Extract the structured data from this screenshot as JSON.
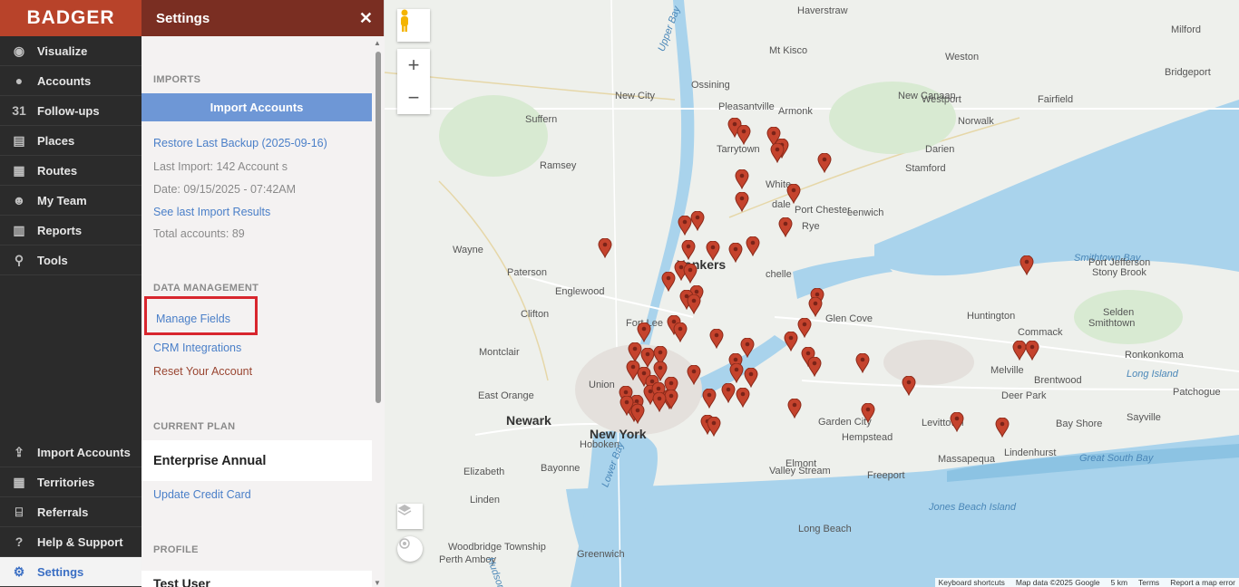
{
  "brand": "BADGER",
  "nav": {
    "top": [
      {
        "label": "Visualize",
        "icon": "eye-icon",
        "glyph": "◉"
      },
      {
        "label": "Accounts",
        "icon": "user-icon",
        "glyph": "●"
      },
      {
        "label": "Follow-ups",
        "icon": "calendar-icon",
        "glyph": "31"
      },
      {
        "label": "Places",
        "icon": "store-icon",
        "glyph": "▤"
      },
      {
        "label": "Routes",
        "icon": "map-icon",
        "glyph": "▦"
      },
      {
        "label": "My Team",
        "icon": "team-icon",
        "glyph": "☻"
      },
      {
        "label": "Reports",
        "icon": "report-icon",
        "glyph": "▥"
      },
      {
        "label": "Tools",
        "icon": "pin-tool-icon",
        "glyph": "⚲"
      }
    ],
    "bottom": [
      {
        "label": "Import Accounts",
        "icon": "upload-icon",
        "glyph": "⇪"
      },
      {
        "label": "Territories",
        "icon": "grid-icon",
        "glyph": "▦"
      },
      {
        "label": "Referrals",
        "icon": "gift-icon",
        "glyph": "⌸"
      },
      {
        "label": "Help & Support",
        "icon": "help-icon",
        "glyph": "?"
      },
      {
        "label": "Settings",
        "icon": "gear-icon",
        "glyph": "⚙"
      }
    ]
  },
  "panel": {
    "title": "Settings",
    "close": "✕",
    "imports": {
      "title": "IMPORTS",
      "button": "Import Accounts",
      "restore": "Restore Last Backup (2025-09-16)",
      "last_import": "Last Import: 142 Account s",
      "date": "Date: 09/15/2025 - 07:42AM",
      "results": "See last Import Results",
      "total": "Total accounts: 89"
    },
    "data_management": {
      "title": "DATA MANAGEMENT",
      "manage_fields": "Manage Fields",
      "crm": "CRM Integrations",
      "reset": "Reset Your Account"
    },
    "plan": {
      "title": "CURRENT PLAN",
      "name": "Enterprise Annual",
      "update": "Update Credit Card"
    },
    "profile": {
      "title": "PROFILE",
      "user": "Test User"
    }
  },
  "map": {
    "labels": [
      "Haverstraw",
      "Mt Kisco",
      "New City",
      "Ossining",
      "Pleasantville",
      "Weston",
      "Milford",
      "Bridgeport",
      "New Canaan",
      "Westport",
      "Fairfield",
      "Suffern",
      "Armonk",
      "Norwalk",
      "Tarrytown",
      "Darien",
      "Ramsey",
      "Stamford",
      "White",
      "dale",
      "Port Chester",
      "eenwich",
      "Rye",
      "Wayne",
      "Yonkers",
      "Paterson",
      "chelle",
      "Smithtown Bay",
      "Port Jefferson",
      "Stony Brook",
      "Englewood",
      "Huntington",
      "Commack",
      "Selden",
      "Glen Cove",
      "Fort Lee",
      "Smithtown",
      "Clifton",
      "Montclair",
      "Ronkonkoma",
      "Long Island",
      "Melville",
      "Brentwood",
      "Deer Park",
      "Union",
      "East Orange",
      "Newark",
      "New York",
      "Garden City",
      "Levittown",
      "Bay Shore",
      "Sayville",
      "Patchogue",
      "Hoboken",
      "Hempstead",
      "Massapequa",
      "Lindenhurst",
      "Great South Bay",
      "Elizabeth",
      "Bayonne",
      "Elmont",
      "Valley Stream",
      "Freeport",
      "Linden",
      "Jones Beach Island",
      "Long Beach",
      "Woodbridge Township",
      "Perth Amboy",
      "Hudson River",
      "Upper Bay",
      "Lower Bay",
      "Greenwich"
    ],
    "footer": [
      "Keyboard shortcuts",
      "Map data ©2025 Google",
      "5 km",
      "Terms",
      "Report a map error"
    ]
  }
}
